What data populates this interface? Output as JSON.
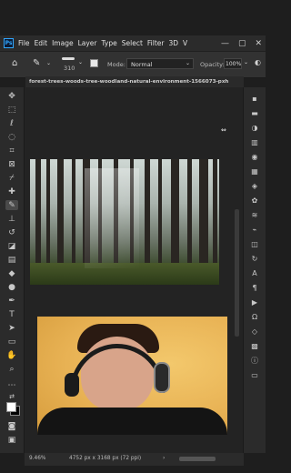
{
  "menubar": {
    "logo": "Ps",
    "items": [
      "File",
      "Edit",
      "Image",
      "Layer",
      "Type",
      "Select",
      "Filter",
      "3D",
      "V"
    ],
    "controls": [
      "—",
      "▢",
      "✕"
    ]
  },
  "options": {
    "brush_size": "310",
    "mode_label": "Mode:",
    "mode_value": "Normal",
    "opacity_label": "Opacity:",
    "opacity_value": "100%"
  },
  "document": {
    "tab_title": "forest-trees-woods-tree-woodland-natural-environment-1566073-pxh"
  },
  "status": {
    "zoom": "9.46%",
    "doc_info": "4752 px x 3168 px (72 ppi)"
  },
  "left_tools": [
    "move-icon",
    "marquee-icon",
    "lasso-icon",
    "quick-select-icon",
    "crop-icon",
    "frame-icon",
    "eyedropper-icon",
    "healing-icon",
    "brush-icon",
    "stamp-icon",
    "history-brush-icon",
    "eraser-icon",
    "gradient-icon",
    "blur-icon",
    "dodge-icon",
    "pen-icon",
    "type-icon",
    "path-select-icon",
    "rectangle-icon",
    "hand-icon",
    "zoom-icon",
    "more-tools-icon",
    "swap-colors-icon",
    "colors-icon",
    "quick-mask-icon",
    "screen-mode-icon"
  ],
  "right_panels": [
    "properties-icon",
    "comments-icon",
    "adjustments-icon",
    "libraries-icon",
    "styles-icon",
    "swatches-icon",
    "color-icon",
    "brushes-icon",
    "channels-icon",
    "paths-icon",
    "layers-icon",
    "history-icon",
    "character-icon",
    "paragraph-icon",
    "actions-icon",
    "glyphs-icon",
    "shapes-icon",
    "patterns-icon",
    "info-icon",
    "timeline-icon"
  ]
}
